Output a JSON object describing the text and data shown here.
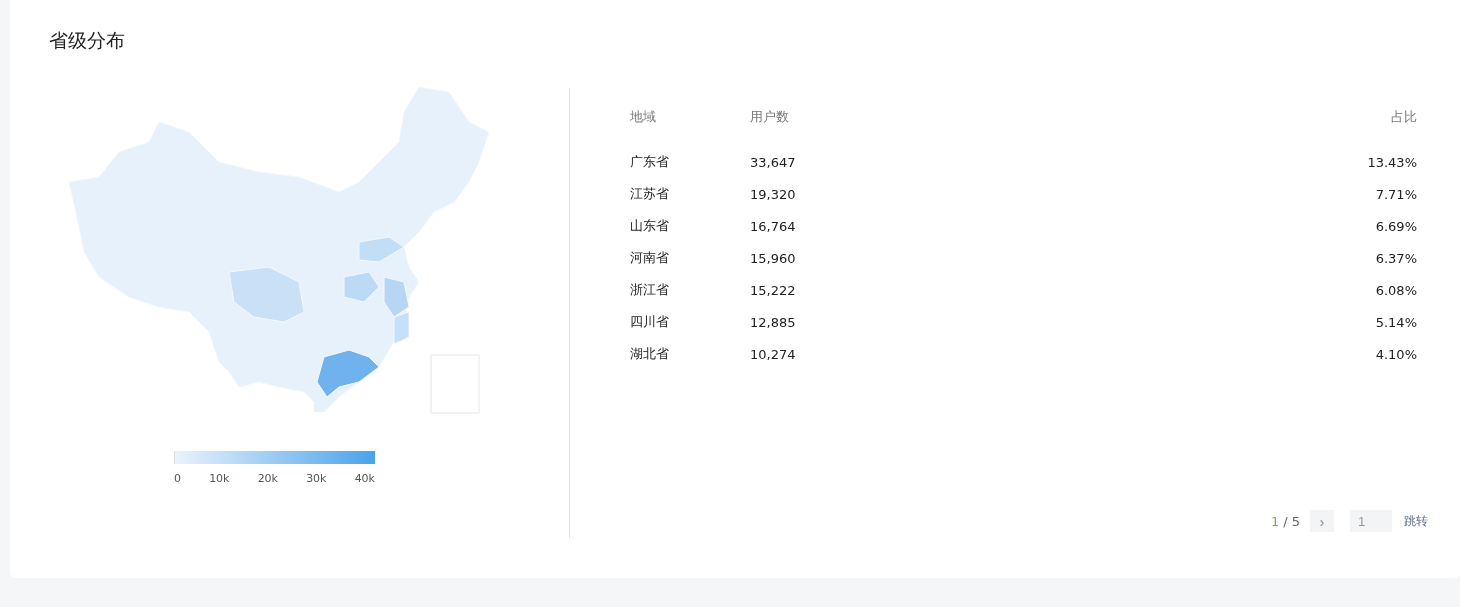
{
  "title": "省级分布",
  "legend": {
    "labels": [
      "0",
      "10k",
      "20k",
      "30k",
      "40k"
    ]
  },
  "table": {
    "columns": [
      "地域",
      "用户数",
      "占比"
    ],
    "rows": [
      {
        "region": "广东省",
        "users": "33,647",
        "share": "13.43%"
      },
      {
        "region": "江苏省",
        "users": "19,320",
        "share": "7.71%"
      },
      {
        "region": "山东省",
        "users": "16,764",
        "share": "6.69%"
      },
      {
        "region": "河南省",
        "users": "15,960",
        "share": "6.37%"
      },
      {
        "region": "浙江省",
        "users": "15,222",
        "share": "6.08%"
      },
      {
        "region": "四川省",
        "users": "12,885",
        "share": "5.14%"
      },
      {
        "region": "湖北省",
        "users": "10,274",
        "share": "4.10%"
      }
    ]
  },
  "pagination": {
    "current": "1",
    "rest": "/ 5",
    "next": "›",
    "page_input": "1",
    "jump": "跳转"
  }
}
